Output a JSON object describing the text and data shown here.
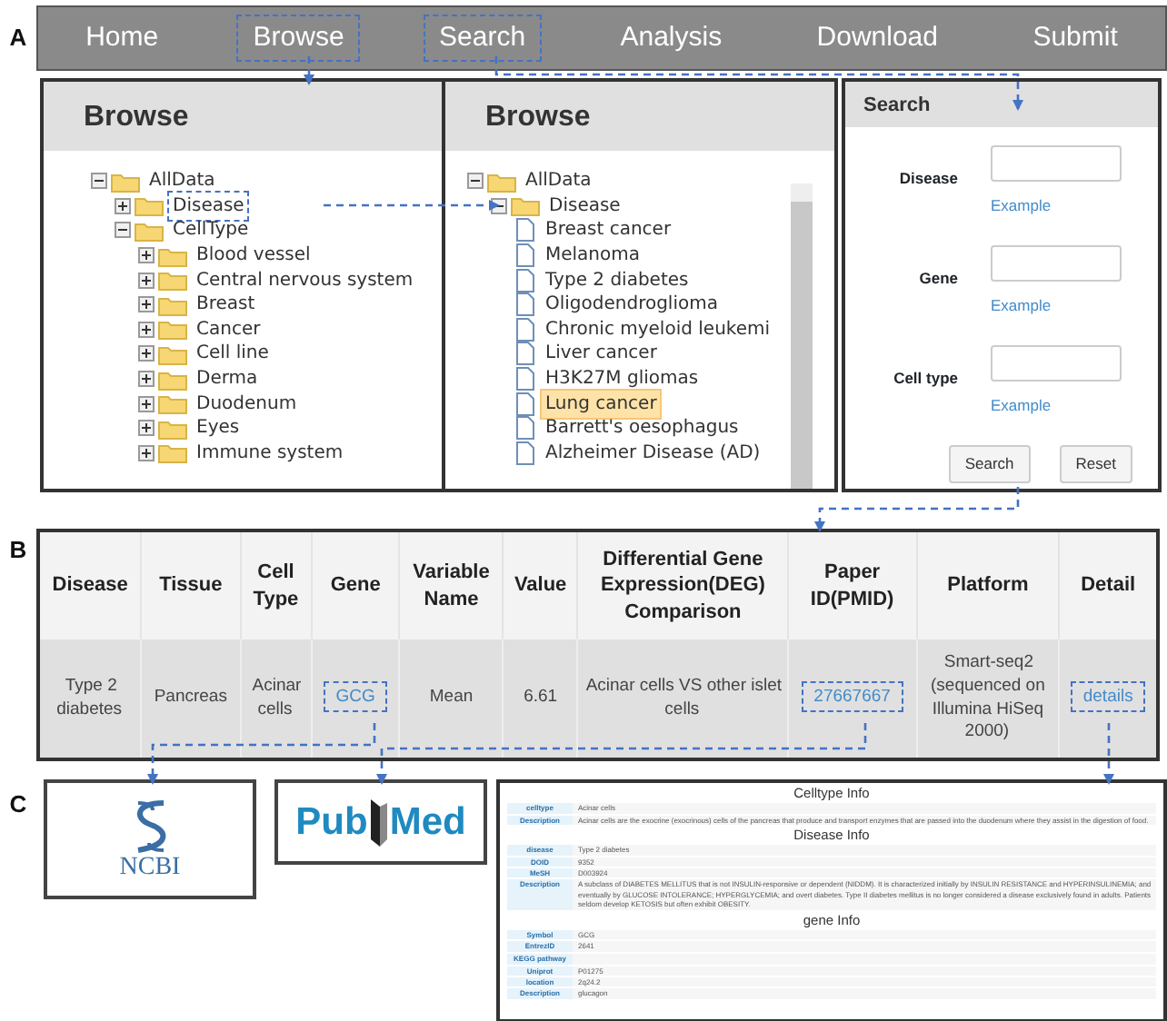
{
  "panel_labels": [
    "A",
    "B",
    "C"
  ],
  "nav": [
    {
      "label": "Home",
      "annotated": false
    },
    {
      "label": "Browse",
      "annotated": true
    },
    {
      "label": "Search",
      "annotated": true
    },
    {
      "label": "Analysis",
      "annotated": false
    },
    {
      "label": "Download",
      "annotated": false
    },
    {
      "label": "Submit",
      "annotated": false
    }
  ],
  "browse_panels": [
    {
      "title": "Browse",
      "scrollbar": false,
      "tree": [
        {
          "label": "AllData",
          "kind": "folder",
          "expanded": true,
          "children": [
            {
              "label": "Disease",
              "kind": "folder",
              "expanded": false,
              "annotated": true
            },
            {
              "label": "CellType",
              "kind": "folder",
              "expanded": true,
              "children": [
                {
                  "label": "Blood vessel",
                  "kind": "folder",
                  "expanded": false
                },
                {
                  "label": "Central nervous system",
                  "kind": "folder",
                  "expanded": false
                },
                {
                  "label": "Breast",
                  "kind": "folder",
                  "expanded": false
                },
                {
                  "label": "Cancer",
                  "kind": "folder",
                  "expanded": false
                },
                {
                  "label": "Cell line",
                  "kind": "folder",
                  "expanded": false
                },
                {
                  "label": "Derma",
                  "kind": "folder",
                  "expanded": false
                },
                {
                  "label": "Duodenum",
                  "kind": "folder",
                  "expanded": false
                },
                {
                  "label": "Eyes",
                  "kind": "folder",
                  "expanded": false
                },
                {
                  "label": "Immune system",
                  "kind": "folder",
                  "expanded": false
                }
              ]
            }
          ]
        }
      ]
    },
    {
      "title": "Browse",
      "scrollbar": true,
      "tree": [
        {
          "label": "AllData",
          "kind": "folder",
          "expanded": true,
          "children": [
            {
              "label": "Disease",
              "kind": "folder",
              "expanded": true,
              "children": [
                {
                  "label": "Breast cancer",
                  "kind": "file",
                  "selected": false
                },
                {
                  "label": "Melanoma",
                  "kind": "file",
                  "selected": false
                },
                {
                  "label": "Type 2 diabetes",
                  "kind": "file",
                  "selected": false
                },
                {
                  "label": "Oligodendroglioma",
                  "kind": "file",
                  "selected": false
                },
                {
                  "label": "Chronic myeloid leukemi",
                  "kind": "file",
                  "selected": false
                },
                {
                  "label": "Liver cancer",
                  "kind": "file",
                  "selected": false
                },
                {
                  "label": "H3K27M gliomas",
                  "kind": "file",
                  "selected": false
                },
                {
                  "label": "Lung cancer",
                  "kind": "file",
                  "selected": true
                },
                {
                  "label": "Barrett's oesophagus",
                  "kind": "file",
                  "selected": false
                },
                {
                  "label": "Alzheimer Disease (AD)",
                  "kind": "file",
                  "selected": false
                }
              ]
            }
          ]
        }
      ]
    }
  ],
  "search": {
    "title": "Search",
    "fields": [
      {
        "label": "Disease",
        "link": "Example"
      },
      {
        "label": "Gene",
        "link": "Example"
      },
      {
        "label": "Cell type",
        "link": "Example"
      }
    ],
    "buttons": [
      "Search",
      "Reset"
    ]
  },
  "table": {
    "columns": [
      "Disease",
      "Tissue",
      "Cell Type",
      "Gene",
      "Variable Name",
      "Value",
      "Differential Gene Expression(DEG) Comparison",
      "Paper ID(PMID)",
      "Platform",
      "Detail"
    ],
    "rows": [
      [
        {
          "text": "Type 2 diabetes",
          "link": false,
          "annotated": false
        },
        {
          "text": "Pancreas",
          "link": false,
          "annotated": false
        },
        {
          "text": "Acinar cells",
          "link": false,
          "annotated": false
        },
        {
          "text": "GCG",
          "link": true,
          "annotated": true
        },
        {
          "text": "Mean",
          "link": false,
          "annotated": false
        },
        {
          "text": "6.61",
          "link": false,
          "annotated": false
        },
        {
          "text": "Acinar cells VS other islet cells",
          "link": false,
          "annotated": false
        },
        {
          "text": "27667667",
          "link": true,
          "annotated": true
        },
        {
          "text": "Smart-seq2 (sequenced on Illumina HiSeq 2000)",
          "link": false,
          "annotated": false
        },
        {
          "text": "details",
          "link": true,
          "annotated": true
        }
      ]
    ]
  },
  "ncbi_logo": {
    "text": "NCBI"
  },
  "pubmed_logo": {
    "left": "Pub",
    "right": "Med"
  },
  "detail_page": {
    "sections": [
      {
        "title": "Celltype Info",
        "rows": [
          {
            "key": "celltype",
            "value": "Acinar cells"
          },
          {
            "key": "Description",
            "value": "Acinar cells are the exocrine (exocrinous) cells of the pancreas that produce and transport enzymes that are passed into the duodenum where they assist in the digestion of food."
          }
        ]
      },
      {
        "title": "Disease Info",
        "rows": [
          {
            "key": "disease",
            "value": "Type 2 diabetes"
          },
          {
            "key": "DOID",
            "value": "9352"
          },
          {
            "key": "MeSH",
            "value": "D003924"
          },
          {
            "key": "Description",
            "value": "A subclass of DIABETES MELLITUS that is not INSULIN-responsive or dependent (NIDDM). It is characterized initially by INSULIN RESISTANCE and HYPERINSULINEMIA; and eventually by GLUCOSE INTOLERANCE; HYPERGLYCEMIA; and overt diabetes. Type II diabetes mellitus is no longer considered a disease exclusively found in adults. Patients seldom develop KETOSIS but often exhibit OBESITY."
          }
        ]
      },
      {
        "title": "gene Info",
        "rows": [
          {
            "key": "Symbol",
            "value": "GCG"
          },
          {
            "key": "EntrezID",
            "value": "2641"
          },
          {
            "key": "KEGG pathway",
            "value": ""
          },
          {
            "key": "Uniprot",
            "value": "P01275"
          },
          {
            "key": "location",
            "value": "2q24.2"
          },
          {
            "key": "Description",
            "value": "glucagon"
          }
        ]
      }
    ]
  }
}
